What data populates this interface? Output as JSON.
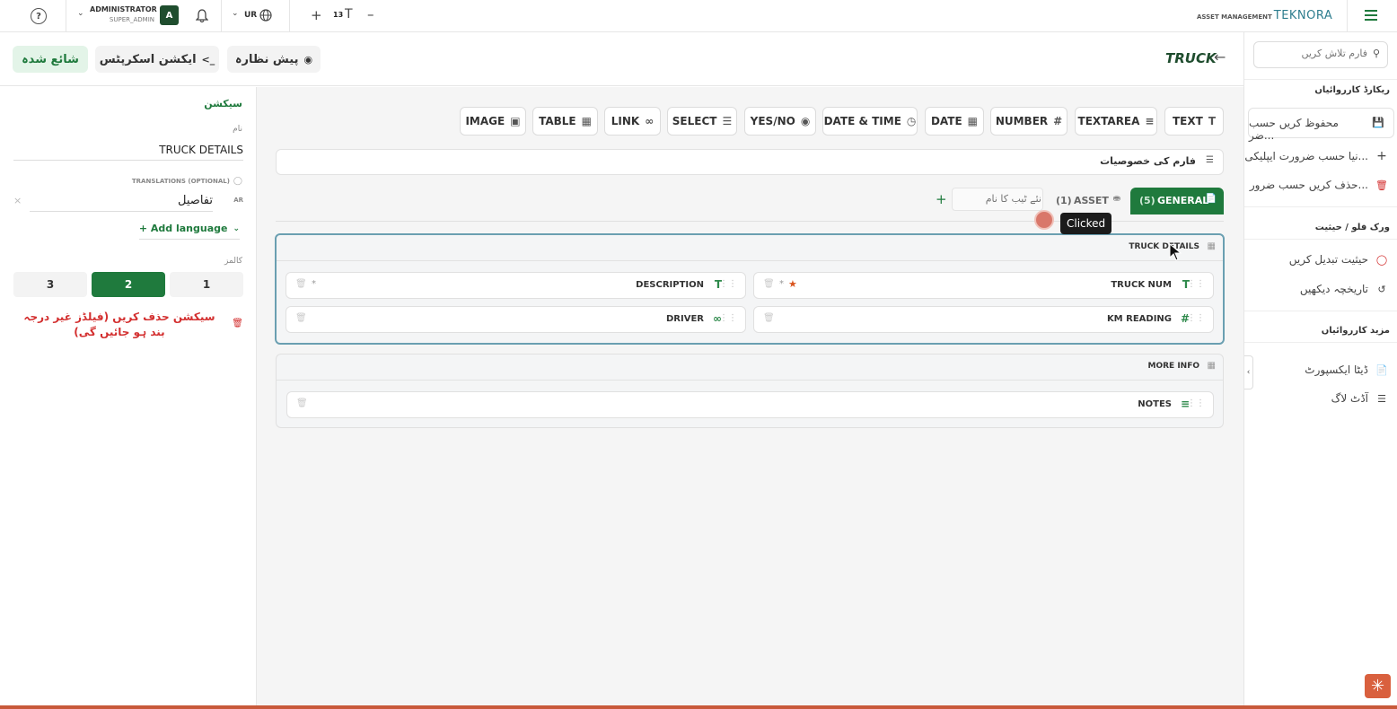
{
  "topbar": {
    "brand_sub": "ASSET MANAGEMENT",
    "brand_main": "TEKNORA",
    "font_size_value": "13",
    "language": "UR",
    "user_name": "ADMINISTRATOR",
    "user_role": "SUPER_ADMIN",
    "avatar_letter": "A"
  },
  "sidebar": {
    "search_placeholder": "فارم تلاش کریں",
    "heading_records": "ریکارڈ کارروائیاں",
    "item_save": "محفوظ کریں حسب ضر...",
    "item_new": "نیا حسب ضرورت ایپلیکی...",
    "item_delete": "حذف کریں حسب ضرور...",
    "heading_workflow": "ورک فلو / حیثیت",
    "item_change_status": "حیثیت تبدیل کریں",
    "item_history": "تاریخچہ دیکھیں",
    "heading_more": "مزید کارروائیاں",
    "item_export": "ڈیٹا ایکسپورٹ",
    "item_audit": "آڈٹ لاگ"
  },
  "header": {
    "form_title": "TRUCK",
    "preview_label": "پیش نظارہ",
    "action_scripts_label": "ایکشن اسکرپٹس",
    "published_label": "شائع شدہ"
  },
  "field_types": [
    "TEXT",
    "TEXTAREA",
    "NUMBER",
    "DATE",
    "DATE & TIME",
    "YES/NO",
    "SELECT",
    "LINK",
    "TABLE",
    "IMAGE"
  ],
  "form_properties_label": "فارم کی خصوصیات",
  "tabs": {
    "general_label": "GENERAL",
    "general_count": "(5)",
    "asset_label": "ASSET",
    "asset_count": "(1)",
    "new_tab_placeholder": "نئے ٹیب کا نام"
  },
  "sections": [
    {
      "title": "TRUCK DETAILS",
      "fields": [
        {
          "name": "TRUCK NUM",
          "icon": "text-icon",
          "required": true
        },
        {
          "name": "DESCRIPTION",
          "icon": "text-icon",
          "required": false
        },
        {
          "name": "KM READING",
          "icon": "hash-icon",
          "required": false
        },
        {
          "name": "DRIVER",
          "icon": "link-icon",
          "required": false
        }
      ]
    },
    {
      "title": "MORE INFO",
      "fields": [
        {
          "name": "NOTES",
          "icon": "textarea-icon",
          "required": false
        }
      ]
    }
  ],
  "tooltip": "Clicked",
  "panel": {
    "heading": "سیکشن",
    "name_label": "نام",
    "name_value": "TRUCK DETAILS",
    "translations_label": "TRANSLATIONS (OPTIONAL)",
    "translation_lang": "AR",
    "translation_value": "تفاصيل",
    "add_language": "+ Add language",
    "columns_label": "کالمز",
    "columns": [
      "1",
      "2",
      "3"
    ],
    "selected_column": "2",
    "delete_section": "سیکشن حذف کریں (فیلڈز غیر درجہ بند ہو جائیں گی)"
  },
  "colors": {
    "brand_green": "#1f7a3d",
    "selected_section_border": "#6a9fb1",
    "danger": "#d32f2f",
    "bottom_bar": "#c8593a"
  }
}
